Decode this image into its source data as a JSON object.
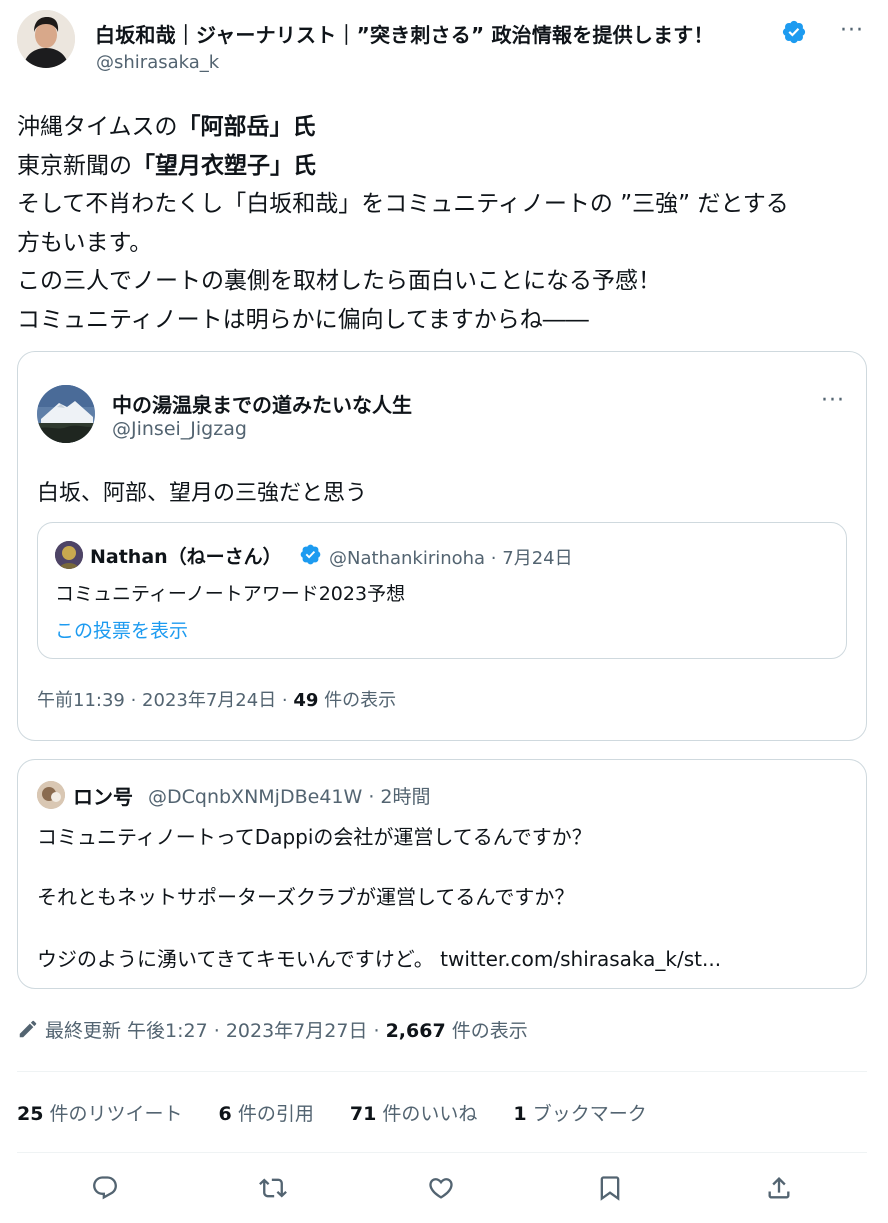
{
  "author": {
    "name": "白坂和哉｜ジャーナリスト｜”突き刺さる” 政治情報を提供します！",
    "handle": "@shirasaka_k",
    "more": "···"
  },
  "tweet": {
    "l1_a": "沖縄タイムスの",
    "l1_b": "「阿部岳」氏",
    "l2_a": "東京新聞の",
    "l2_b": "「望月衣塑子」氏",
    "l3": "そして不肖わたくし「白坂和哉」をコミュニティノートの ”三強” だとする",
    "l4": "方もいます。",
    "l5": "この三人でノートの裏側を取材したら面白いことになる予感！",
    "l6": "コミュニティノートは明らかに偏向してますからね――"
  },
  "quote": {
    "name": "中の湯温泉までの道みたいな人生",
    "handle": "@Jinsei_Jigzag",
    "more": "···",
    "text": "白坂、阿部、望月の三強だと思う",
    "inner": {
      "name": "Nathan（ねーさん）",
      "meta": "@Nathankirinoha · 7月24日",
      "text": "コミュニティーノートアワード2023予想",
      "link": "この投票を表示"
    },
    "footer_time": "午前11:39 · 2023年7月24日 · ",
    "footer_views": "49",
    "footer_views_label": " 件の表示"
  },
  "reply": {
    "name": "ロン号",
    "meta": "@DCqnbXNMjDBe41W · 2時間",
    "line1": "コミュニティノートってDappiの会社が運営してるんですか？",
    "line2": "それともネットサポーターズクラブが運営してるんですか？",
    "line3_text": "ウジのように湧いてきてキモいんですけど。 ",
    "line3_link": "twitter.com/shirasaka_k/st..."
  },
  "edit": {
    "label": "最終更新 午後1:27 · 2023年7月27日 · ",
    "views": "2,667",
    "views_label": " 件の表示"
  },
  "stats": [
    {
      "count": "25",
      "label": " 件のリツイート"
    },
    {
      "count": "6",
      "label": " 件の引用"
    },
    {
      "count": "71",
      "label": " 件のいいね"
    },
    {
      "count": "1",
      "label": " ブックマーク"
    }
  ],
  "colors": {
    "text": "#0f1419",
    "muted": "#536471",
    "link": "#1d9bf0",
    "border": "#cfd9de"
  },
  "icons": [
    "verified-icon",
    "more-icon",
    "pencil-icon",
    "reply-icon",
    "retweet-icon",
    "like-icon",
    "bookmark-icon",
    "share-icon"
  ]
}
